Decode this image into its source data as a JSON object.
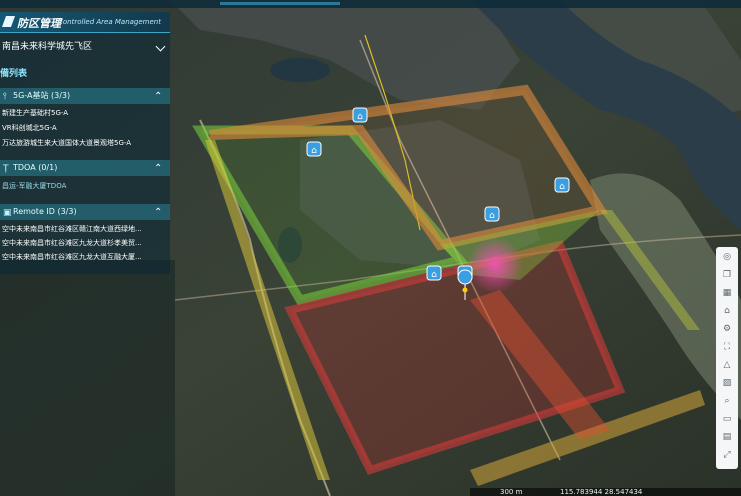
{
  "panel": {
    "title": "防区管理",
    "subtitle": "Controlled Area Management",
    "region": "南昌未来科学城先飞区",
    "list_title": "備列表",
    "sections": [
      {
        "icon": "antenna-icon",
        "label": "5G-A基站 (3/3)",
        "items": [
          "新建生产基础村5G-A",
          "VR科创城北5G-A",
          "万达旅游城生来大道国体大道景观塔5G-A"
        ]
      },
      {
        "icon": "tdoa-icon",
        "label": "TDOA (0/1)",
        "items": [
          "昌运-军融大厦TDOA"
        ]
      },
      {
        "icon": "remote-id-icon",
        "label": "Remote ID (3/3)",
        "items": [
          "空中未来南昌市红谷滩区赣江南大道西绿地...",
          "空中未来南昌市红谷滩区九龙大道杉孝美贸...",
          "空中未来南昌市红谷滩区九龙大道互融大厦..."
        ]
      }
    ]
  },
  "toolbar": {
    "tools": [
      "layers-icon",
      "copy-icon",
      "grid-icon",
      "home-icon",
      "settings-icon",
      "fullscreen-icon",
      "warning-icon",
      "image-icon",
      "search-icon",
      "folder-icon",
      "calendar-icon",
      "expand-icon"
    ]
  },
  "statusbar": {
    "scale": "300 m",
    "coords": "115.783944 28.547434"
  },
  "colors": {
    "zone_orange": "#e08a3a",
    "zone_green": "#7cd23c",
    "zone_red": "#e03a3a",
    "zone_yellow": "#d6c23a",
    "marker_blue": "#3a9ee0",
    "hotspot_pink": "#e040a0"
  }
}
